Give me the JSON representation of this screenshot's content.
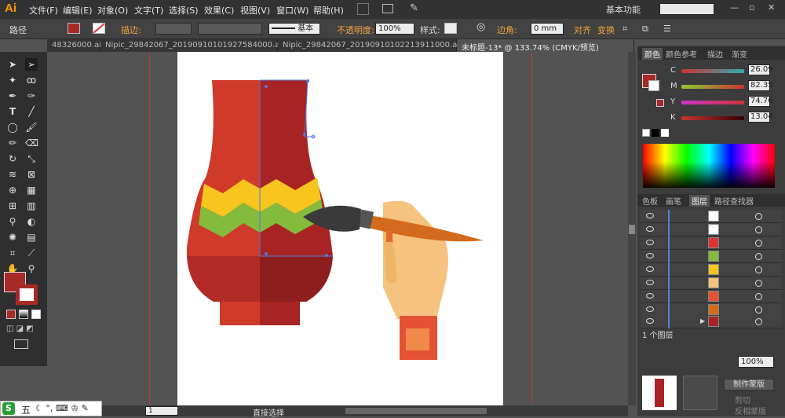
{
  "app": {
    "logo": "Ai"
  },
  "menu": [
    "文件(F)",
    "编辑(E)",
    "对象(O)",
    "文字(T)",
    "选择(S)",
    "效果(C)",
    "视图(V)",
    "窗口(W)",
    "帮助(H)"
  ],
  "workspace": "基本功能",
  "control": {
    "object_type": "路径",
    "stroke_label": "描边:",
    "stroke_style": "基本",
    "opacity_label": "不透明度:",
    "opacity_value": "100%",
    "style_label": "样式:",
    "corner_label": "边角:",
    "corner_value": "0 mm",
    "align_label": "对齐",
    "transform_label": "变换"
  },
  "tabs": [
    {
      "label": "48326000.ai*",
      "active": false
    },
    {
      "label": "Nipic_29842067_20190910101927584000.ai*",
      "active": false
    },
    {
      "label": "Nipic_29842067_20190910102213911000.ai*",
      "active": false
    },
    {
      "label": "未标题-13* @ 133.74% (CMYK/预览)",
      "active": true
    }
  ],
  "color_panel": {
    "tabs": [
      "颜色",
      "颜色参考",
      "描边",
      "渐变"
    ],
    "channels": [
      {
        "name": "C",
        "value": "26.09"
      },
      {
        "name": "M",
        "value": "82.35"
      },
      {
        "name": "Y",
        "value": "74.76"
      },
      {
        "name": "K",
        "value": "13.04"
      }
    ],
    "fill_color": "#a82a27"
  },
  "layers_panel": {
    "tabs": [
      "色板",
      "画笔",
      "图层",
      "路径查找器"
    ],
    "count_label": "1 个图层"
  },
  "bottom_panel": {
    "opacity_value": "100%",
    "make_mask": "制作蒙版",
    "clip": "剪切",
    "invert_mask": "反相蒙版"
  },
  "status": {
    "zoom_page": "1",
    "tool_name": "直接选择"
  },
  "taskbar": {
    "items": [
      "五"
    ]
  },
  "colors": {
    "vase_left": "#cf3a2a",
    "vase_right": "#a82424",
    "vase_base_left": "#b22b27",
    "vase_base_right": "#8e1d1d",
    "zigzag_yellow": "#f7c51e",
    "zigzag_green": "#84bb3c",
    "hand": "#f5c37e",
    "cuff": "#e55232",
    "brush_handle": "#d46a1c"
  }
}
